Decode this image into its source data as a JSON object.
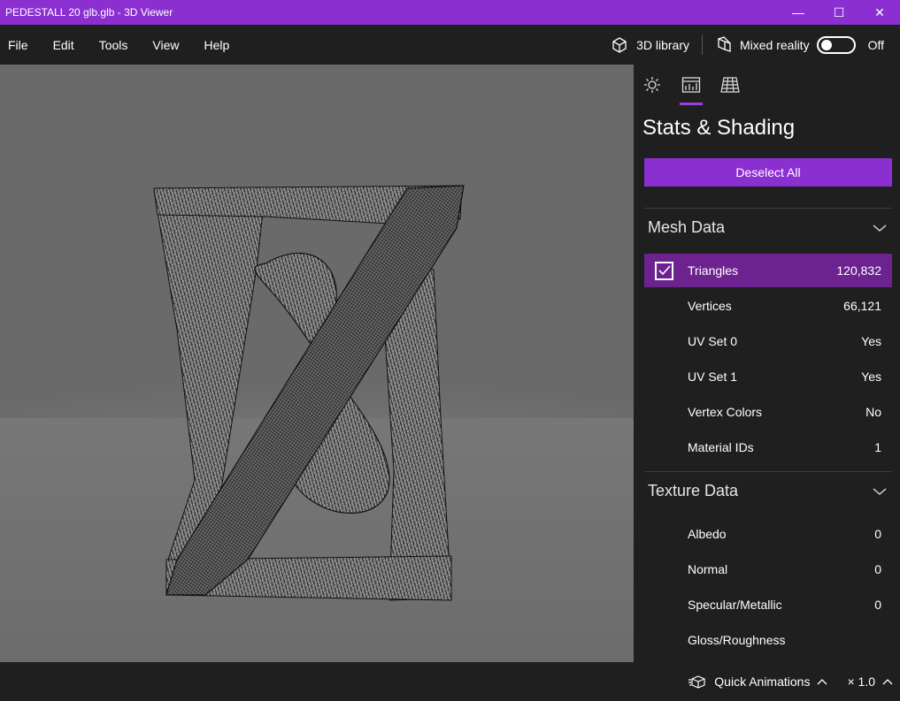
{
  "window": {
    "title": "PEDESTALL 20 glb.glb - 3D Viewer",
    "minimize_glyph": "—",
    "maximize_glyph": "☐",
    "close_glyph": "✕"
  },
  "menu": {
    "items": [
      "File",
      "Edit",
      "Tools",
      "View",
      "Help"
    ],
    "library_label": "3D library",
    "mixed_reality_label": "Mixed reality",
    "mixed_reality_state": "Off"
  },
  "panel": {
    "tabs": [
      "sun-icon",
      "stats-icon",
      "grid-icon"
    ],
    "title": "Stats & Shading",
    "deselect_label": "Deselect All",
    "mesh_section": {
      "title": "Mesh Data",
      "rows": [
        {
          "label": "Triangles",
          "value": "120,832",
          "selected": true
        },
        {
          "label": "Vertices",
          "value": "66,121"
        },
        {
          "label": "UV Set 0",
          "value": "Yes"
        },
        {
          "label": "UV Set 1",
          "value": "Yes"
        },
        {
          "label": "Vertex Colors",
          "value": "No"
        },
        {
          "label": "Material IDs",
          "value": "1"
        }
      ]
    },
    "texture_section": {
      "title": "Texture Data",
      "rows": [
        {
          "label": "Albedo",
          "value": "0"
        },
        {
          "label": "Normal",
          "value": "0"
        },
        {
          "label": "Specular/Metallic",
          "value": "0"
        },
        {
          "label": "Gloss/Roughness",
          "value": ""
        }
      ]
    }
  },
  "bottom": {
    "quick_animations_label": "Quick Animations",
    "speed_label": "× 1.0"
  },
  "colors": {
    "accent": "#8b2fd1",
    "selected_row": "#6d238f",
    "background": "#1f1f1f",
    "viewport": "#6e6e6e"
  }
}
